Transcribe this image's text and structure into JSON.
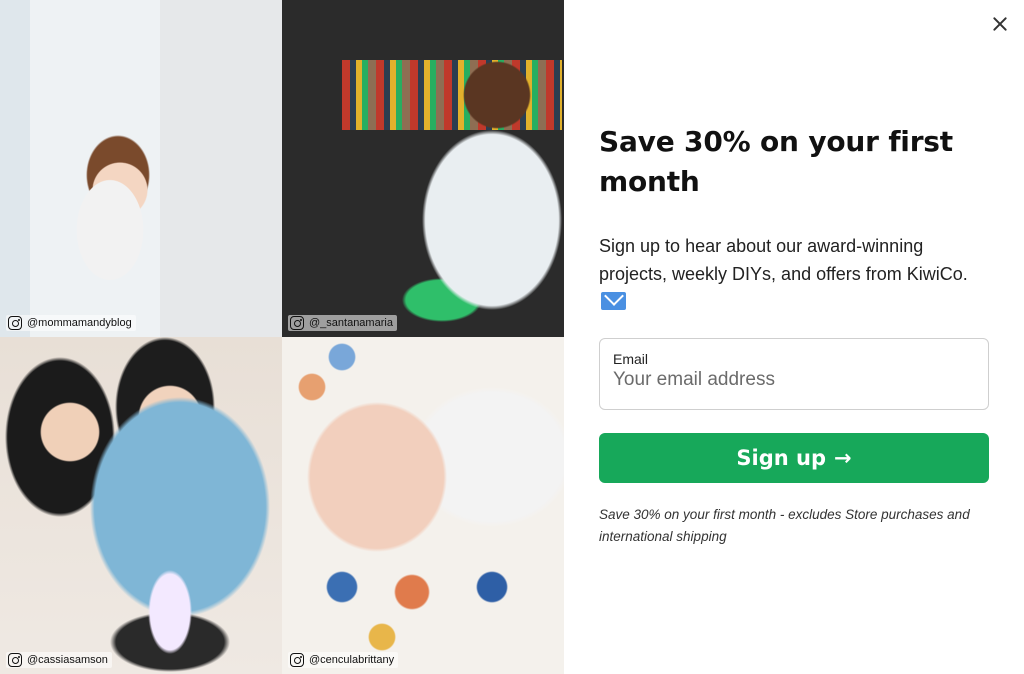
{
  "photos": [
    {
      "handle": "@mommamandyblog",
      "icon": "instagram-icon"
    },
    {
      "handle": "@_santanamaria",
      "icon": "instagram-icon"
    },
    {
      "handle": "@cassiasamson",
      "icon": "instagram-icon"
    },
    {
      "handle": "@cenculabrittany",
      "icon": "instagram-icon"
    }
  ],
  "close_icon": "close-icon",
  "headline": "Save 30% on your first month",
  "subtext": "Sign up to hear about our award-winning projects, weekly DIYs, and offers from KiwiCo.",
  "subtext_icon": "envelope-icon",
  "email_field": {
    "label": "Email",
    "placeholder": "Your email address",
    "value": ""
  },
  "signup_button": {
    "label": "Sign up",
    "arrow": "→",
    "color": "#17a85a"
  },
  "disclaimer": "Save 30% on your first month - excludes Store purchases and international shipping"
}
